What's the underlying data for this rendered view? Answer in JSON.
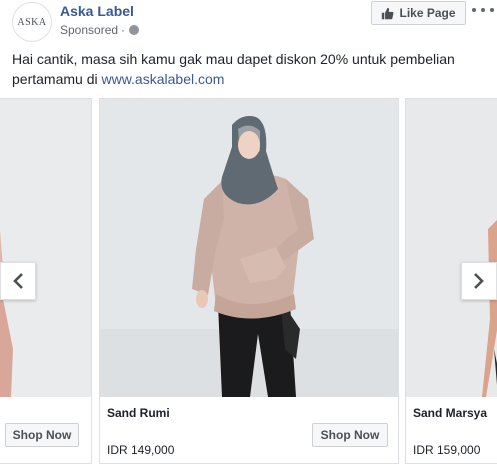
{
  "page": {
    "name": "Aska Label",
    "avatar_text": "ASKA",
    "sponsored": "Sponsored",
    "separator": "·"
  },
  "like_button": {
    "label": "Like Page"
  },
  "post": {
    "text": "Hai cantik, masa sih kamu gak mau dapet diskon 20% untuk pembelian pertamamu di ",
    "link": "www.askalabel.com"
  },
  "carousel": {
    "cards": [
      {
        "title": "",
        "price": "",
        "button": "Shop Now"
      },
      {
        "title": "Sand Rumi",
        "price": "IDR 149,000",
        "button": "Shop Now"
      },
      {
        "title": "Sand Marsya",
        "price": "IDR 159,000",
        "button": ""
      }
    ]
  },
  "colors": {
    "link": "#385898",
    "text": "#1d2129",
    "muted": "#616770",
    "border": "#dddfe2",
    "button_bg": "#f6f7f9",
    "blouse": "#cfb3a8",
    "hijab": "#5f6a72",
    "trousers": "#1b1b1d"
  },
  "icons": {
    "globe": "globe-icon",
    "thumb": "thumbs-up-icon",
    "more": "more-options-icon",
    "prev": "chevron-left-icon",
    "next": "chevron-right-icon"
  }
}
